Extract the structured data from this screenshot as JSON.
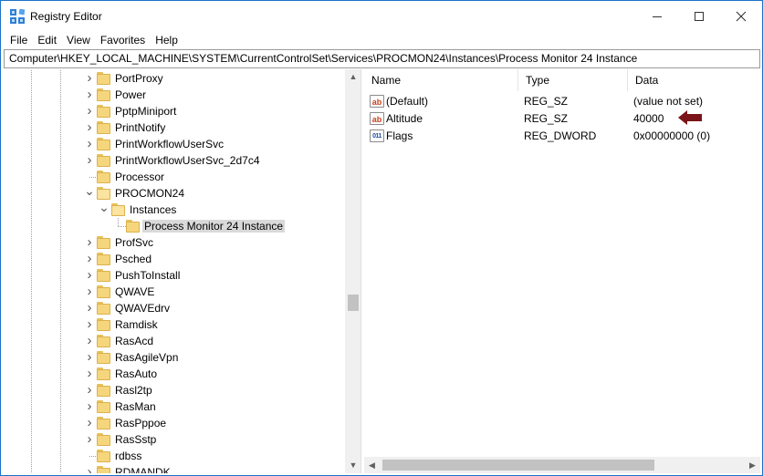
{
  "window": {
    "title": "Registry Editor",
    "accent": "#1a73c7"
  },
  "menu": {
    "items": [
      "File",
      "Edit",
      "View",
      "Favorites",
      "Help"
    ]
  },
  "address": {
    "path": "Computer\\HKEY_LOCAL_MACHINE\\SYSTEM\\CurrentControlSet\\Services\\PROCMON24\\Instances\\Process Monitor 24 Instance"
  },
  "tree": {
    "items": [
      {
        "label": "PortProxy",
        "expand": "collapsed"
      },
      {
        "label": "Power",
        "expand": "collapsed"
      },
      {
        "label": "PptpMiniport",
        "expand": "collapsed"
      },
      {
        "label": "PrintNotify",
        "expand": "collapsed"
      },
      {
        "label": "PrintWorkflowUserSvc",
        "expand": "collapsed"
      },
      {
        "label": "PrintWorkflowUserSvc_2d7c4",
        "expand": "collapsed"
      },
      {
        "label": "Processor",
        "expand": "none"
      },
      {
        "label": "PROCMON24",
        "expand": "expanded"
      },
      {
        "label": "Instances",
        "expand": "expanded"
      },
      {
        "label": "Process Monitor 24 Instance",
        "expand": "none",
        "selected": true
      },
      {
        "label": "ProfSvc",
        "expand": "collapsed"
      },
      {
        "label": "Psched",
        "expand": "collapsed"
      },
      {
        "label": "PushToInstall",
        "expand": "collapsed"
      },
      {
        "label": "QWAVE",
        "expand": "collapsed"
      },
      {
        "label": "QWAVEdrv",
        "expand": "collapsed"
      },
      {
        "label": "Ramdisk",
        "expand": "collapsed"
      },
      {
        "label": "RasAcd",
        "expand": "collapsed"
      },
      {
        "label": "RasAgileVpn",
        "expand": "collapsed"
      },
      {
        "label": "RasAuto",
        "expand": "collapsed"
      },
      {
        "label": "Rasl2tp",
        "expand": "collapsed"
      },
      {
        "label": "RasMan",
        "expand": "collapsed"
      },
      {
        "label": "RasPppoe",
        "expand": "collapsed"
      },
      {
        "label": "RasSstp",
        "expand": "collapsed"
      },
      {
        "label": "rdbss",
        "expand": "none"
      },
      {
        "label": "RDMANDK",
        "expand": "collapsed"
      }
    ]
  },
  "values": {
    "columns": {
      "name": "Name",
      "type": "Type",
      "data": "Data"
    },
    "rows": [
      {
        "icon": "string-value-icon",
        "name": "(Default)",
        "type": "REG_SZ",
        "data": "(value not set)"
      },
      {
        "icon": "string-value-icon",
        "name": "Altitude",
        "type": "REG_SZ",
        "data": "40000"
      },
      {
        "icon": "binary-value-icon",
        "name": "Flags",
        "type": "REG_DWORD",
        "data": "0x00000000 (0)"
      }
    ]
  },
  "annotation": {
    "color": "#7a1418",
    "icon": "left-arrow-icon"
  }
}
